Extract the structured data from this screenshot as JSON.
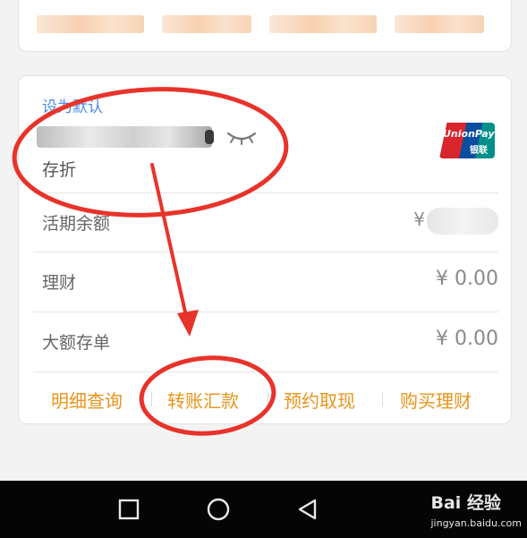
{
  "account": {
    "default_label": "设为默认",
    "type": "存折",
    "card_brand_latin": "UnionPay",
    "card_brand_cn": "银联"
  },
  "rows": {
    "balance_label": "活期余额",
    "balance_currency": "¥",
    "wealth_label": "理财",
    "wealth_value": "¥ 0.00",
    "deposit_label": "大额存单",
    "deposit_value": "¥ 0.00"
  },
  "actions": {
    "detail": "明细查询",
    "transfer": "转账汇款",
    "withdraw": "预约取现",
    "buy": "购买理财"
  },
  "icons": {
    "visibility": "eye-closed-icon",
    "card": "unionpay-logo"
  },
  "navbar": {
    "watermark_logo": "Bai 经验",
    "watermark_url": "jingyan.baidu.com"
  },
  "colors": {
    "accent": "#e8941a",
    "link": "#4d8ae8",
    "annotation": "#e8332a"
  }
}
